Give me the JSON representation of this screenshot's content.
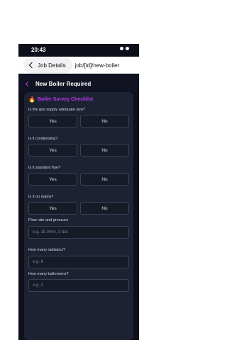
{
  "status_bar": {
    "time": "20:43"
  },
  "nav": {
    "back_label": "Job Details",
    "route": "job/[id]/new-boiler"
  },
  "header": {
    "title": "New Boiler Required"
  },
  "checklist": {
    "title": "Boiler Survey Checklist",
    "questions": [
      {
        "label": "Is the gas supply adequate size?",
        "yes": "Yes",
        "no": "No"
      },
      {
        "label": "Is it condensing?",
        "yes": "Yes",
        "no": "No"
      },
      {
        "label": "Is it standard flue?",
        "yes": "Yes",
        "no": "No"
      },
      {
        "label": "Is it on mains?",
        "yes": "Yes",
        "no": "No"
      }
    ],
    "fields": [
      {
        "label": "Flow rate and pressure",
        "placeholder": "e.g. 15 l/min, 3 bar"
      },
      {
        "label": "How many radiators?",
        "placeholder": "e.g. 8"
      },
      {
        "label": "How many bathrooms?",
        "placeholder": "e.g. 2"
      }
    ]
  },
  "colors": {
    "accent": "#b838f0",
    "background": "#0d0f1a",
    "card": "#1c2232"
  }
}
